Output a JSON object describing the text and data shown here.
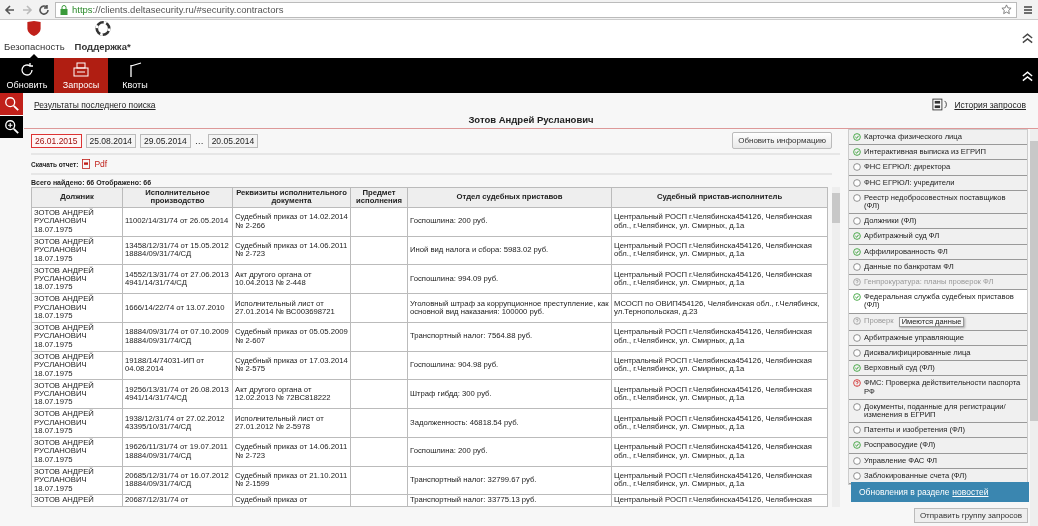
{
  "browser": {
    "url_scheme": "https",
    "url_rest": "://clients.deltasecurity.ru/#security.contractors"
  },
  "sections": [
    {
      "label": "Безопасность",
      "kind": "shield",
      "selected": true
    },
    {
      "label": "Поддержка*",
      "kind": "lifebuoy",
      "selected": false
    }
  ],
  "toolbar": [
    {
      "label": "Обновить",
      "kind": "refresh",
      "selected": false
    },
    {
      "label": "Запросы",
      "kind": "printer",
      "selected": true
    },
    {
      "label": "Квоты",
      "kind": "barrier",
      "selected": false
    }
  ],
  "last_search_link": "Результаты последнего поиска",
  "history_link": "История запросов",
  "person_name": "Зотов Андрей Русланович",
  "dates": [
    {
      "label": "26.01.2015",
      "selected": true
    },
    {
      "label": "25.08.2014",
      "selected": false
    },
    {
      "label": "29.05.2014",
      "selected": false
    },
    {
      "label": "…",
      "kind": "gap"
    },
    {
      "label": "20.05.2014",
      "selected": false
    }
  ],
  "refresh_button": "Обновить информацию",
  "report": {
    "label": "Скачать отчет:",
    "link": "Pdf"
  },
  "totals": "Всего найдено: 66 Отображено: 66",
  "table": {
    "columns": [
      "Должник",
      "Исполнительное производство",
      "Реквизиты исполнительного документа",
      "Предмет исполнения",
      "Отдел судебных приставов",
      "Судебный пристав-исполнитель"
    ],
    "rows": [
      {
        "debtor": "ЗОТОВ АНДРЕЙ РУСЛАНОВИЧ 18.07.1975",
        "proceeding": "11002/14/31/74 от 26.05.2014",
        "document": "Судебный приказ от 14.02.2014 № 2-266",
        "department": "Госпошлина: 200 руб.",
        "bailiff": "Центральный РОСП г.Челябинска454126, Челябинская обл., г.Челябинск, ул. Смирных, д.1а"
      },
      {
        "debtor": "ЗОТОВ АНДРЕЙ РУСЛАНОВИЧ 18.07.1975",
        "proceeding": "13458/12/31/74 от 15.05.2012 18884/09/31/74/СД",
        "document": "Судебный приказ от 14.06.2011 № 2-723",
        "department": "Иной вид налога и сбора: 5983.02 руб.",
        "bailiff": "Центральный РОСП г.Челябинска454126, Челябинская обл., г.Челябинск, ул. Смирных, д.1а"
      },
      {
        "debtor": "ЗОТОВ АНДРЕЙ РУСЛАНОВИЧ 18.07.1975",
        "proceeding": "14552/13/31/74 от 27.06.2013 4941/14/31/74/СД",
        "document": "Акт другого органа от 10.04.2013 № 2-448",
        "department": "Госпошлина: 994.09 руб.",
        "bailiff": "Центральный РОСП г.Челябинска454126, Челябинская обл., г.Челябинск, ул. Смирных, д.1а"
      },
      {
        "debtor": "ЗОТОВ АНДРЕЙ РУСЛАНОВИЧ 18.07.1975",
        "proceeding": "1666/14/22/74 от 13.07.2010",
        "document": "Исполнительный лист от 27.01.2014 № ВС003698721",
        "department": "Уголовный штраф за коррупционное преступление, как основной вид наказания: 100000 руб.",
        "bailiff": "МСОСП по ОВИП454126, Челябинская обл., г.Челябинск, ул.Тернопольская, д.23"
      },
      {
        "debtor": "ЗОТОВ АНДРЕЙ РУСЛАНОВИЧ 18.07.1975",
        "proceeding": "18884/09/31/74 от 07.10.2009 18884/09/31/74/СД",
        "document": "Судебный приказ от 05.05.2009 № 2-607",
        "department": "Транспортный налог: 7564.88 руб.",
        "bailiff": "Центральный РОСП г.Челябинска454126, Челябинская обл., г.Челябинск, ул. Смирных, д.1а"
      },
      {
        "debtor": "ЗОТОВ АНДРЕЙ РУСЛАНОВИЧ 18.07.1975",
        "proceeding": "19188/14/74031-ИП от 04.08.2014",
        "document": "Судебный приказ от 17.03.2014 № 2-575",
        "department": "Госпошлина: 904.98 руб.",
        "bailiff": "Центральный РОСП г.Челябинска454126, Челябинская обл., г.Челябинск, ул. Смирных, д.1а"
      },
      {
        "debtor": "ЗОТОВ АНДРЕЙ РУСЛАНОВИЧ 18.07.1975",
        "proceeding": "19256/13/31/74 от 26.08.2013 4941/14/31/74/СД",
        "document": "Акт другого органа от 12.02.2013 № 72ВС818222",
        "department": "Штраф гибдд: 300 руб.",
        "bailiff": "Центральный РОСП г.Челябинска454126, Челябинская обл., г.Челябинск, ул. Смирных, д.1а"
      },
      {
        "debtor": "ЗОТОВ АНДРЕЙ РУСЛАНОВИЧ 18.07.1975",
        "proceeding": "1938/12/31/74 от 27.02.2012 43395/10/31/74/СД",
        "document": "Исполнительный лист от 27.01.2012 № 2-5978",
        "department": "Задолженность: 46818.54 руб.",
        "bailiff": "Центральный РОСП г.Челябинска454126, Челябинская обл., г.Челябинск, ул. Смирных, д.1а"
      },
      {
        "debtor": "ЗОТОВ АНДРЕЙ РУСЛАНОВИЧ 18.07.1975",
        "proceeding": "19626/11/31/74 от 19.07.2011 18884/09/31/74/СД",
        "document": "Судебный приказ от 14.06.2011 № 2-723",
        "department": "Госпошлина: 200 руб.",
        "bailiff": "Центральный РОСП г.Челябинска454126, Челябинская обл., г.Челябинск, ул. Смирных, д.1а"
      },
      {
        "debtor": "ЗОТОВ АНДРЕЙ РУСЛАНОВИЧ 18.07.1975",
        "proceeding": "20685/12/31/74 от 16.07.2012 18884/09/31/74/СД",
        "document": "Судебный приказ от 21.10.2011 № 2-1599",
        "department": "Транспортный налог: 32799.67 руб.",
        "bailiff": "Центральный РОСП г.Челябинска454126, Челябинская обл., г.Челябинск, ул. Смирных, д.1а"
      },
      {
        "debtor": "ЗОТОВ АНДРЕЙ",
        "proceeding": "20687/12/31/74 от",
        "document": "Судебный приказ от",
        "department": "Транспортный налог: 33775.13 руб.",
        "bailiff": "Центральный РОСП г.Челябинска454126, Челябинская"
      }
    ]
  },
  "sources": [
    {
      "label": "Карточка физического лица",
      "kind": "ok",
      "selected": false
    },
    {
      "label": "Интерактивная выписка из ЕГРИП",
      "kind": "ok",
      "selected": false
    },
    {
      "label": "ФНС ЕГРЮЛ: директора",
      "kind": "none",
      "selected": false
    },
    {
      "label": "ФНС ЕГРЮЛ: учредители",
      "kind": "none",
      "selected": false
    },
    {
      "label": "Реестр недобросовестных поставщиков (ФЛ)",
      "kind": "none",
      "selected": false
    },
    {
      "label": "Должники (ФЛ)",
      "kind": "none",
      "selected": false
    },
    {
      "label": "Арбитражный суд ФЛ",
      "kind": "ok",
      "selected": false
    },
    {
      "label": "Аффилированность ФЛ",
      "kind": "ok",
      "selected": false
    },
    {
      "label": "Данные по банкротам ФЛ",
      "kind": "none",
      "selected": false
    },
    {
      "label": "Генпрокуратура: планы проверок ФЛ",
      "kind": "unknown",
      "selected": false
    },
    {
      "label": "Федеральная служба судебных приставов (ФЛ)",
      "kind": "ok",
      "selected": true
    },
    {
      "label": "Проверк",
      "kind": "unknown",
      "selected": false,
      "tooltip": "Имеются данные"
    },
    {
      "label": "Арбитражные управляющие",
      "kind": "none",
      "selected": false
    },
    {
      "label": "Дисквалифицированные лица",
      "kind": "none",
      "selected": false
    },
    {
      "label": "Верховный суд (ФЛ)",
      "kind": "ok",
      "selected": false
    },
    {
      "label": "ФМС: Проверка действительности паспорта РФ",
      "kind": "error",
      "selected": false
    },
    {
      "label": "Документы, поданные для регистрации/ изменения в ЕГРИП",
      "kind": "none",
      "selected": false
    },
    {
      "label": "Патенты и изобретения (ФЛ)",
      "kind": "none",
      "selected": false
    },
    {
      "label": "Росправосудие (ФЛ)",
      "kind": "ok",
      "selected": false
    },
    {
      "label": "Управление ФАС ФЛ",
      "kind": "none",
      "selected": false
    },
    {
      "label": "Заблокированные счета (ФЛ)",
      "kind": "none",
      "selected": false
    }
  ],
  "send_button": "Отправить группу запросов",
  "notification": {
    "text": "Обновления в разделе",
    "link": "новостей"
  }
}
